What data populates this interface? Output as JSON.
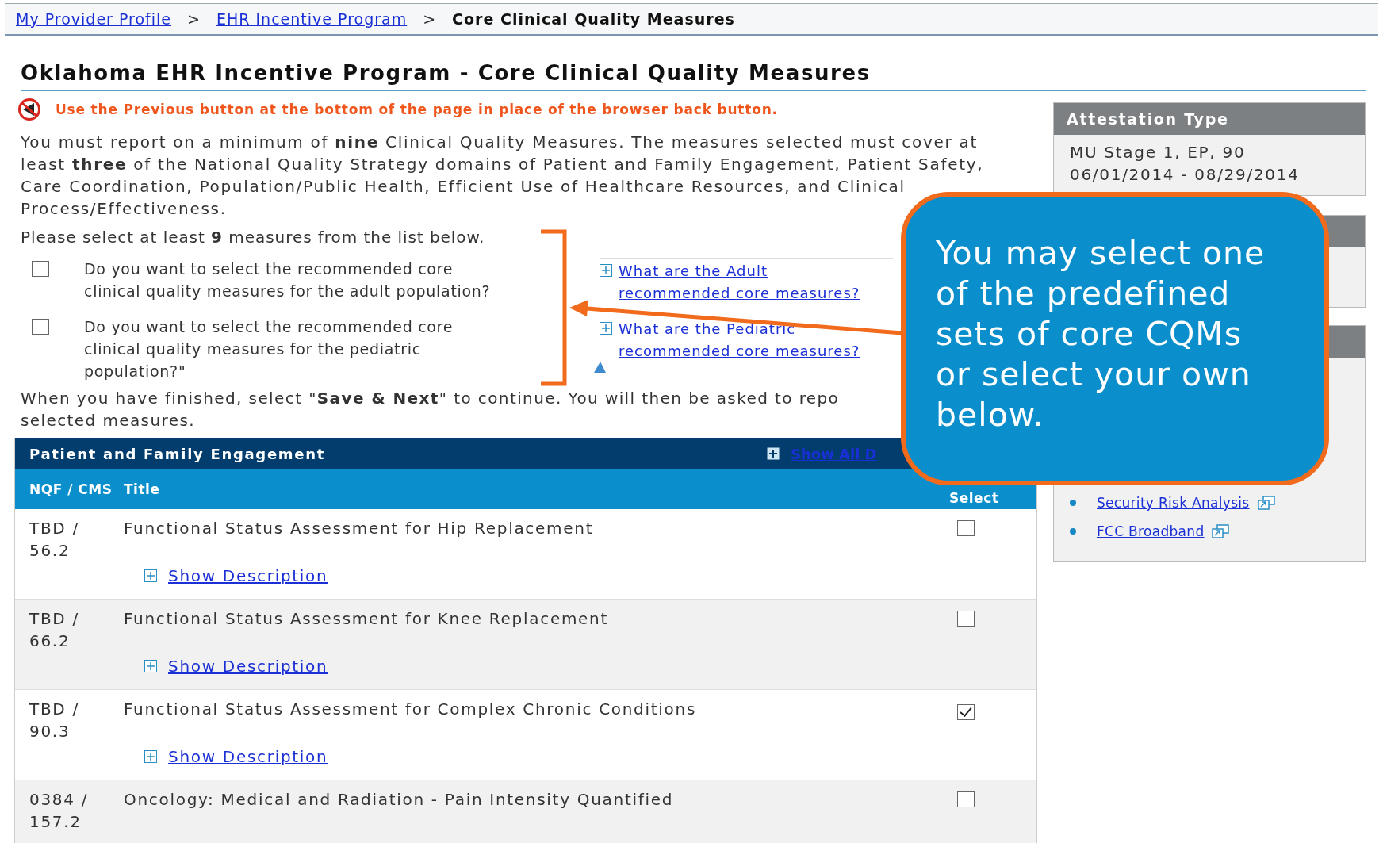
{
  "breadcrumb": [
    {
      "label": "My Provider Profile",
      "link": true
    },
    {
      "label": "EHR Incentive Program",
      "link": true
    },
    {
      "label": "Core Clinical Quality Measures",
      "link": false
    }
  ],
  "breadcrumb_separator": ">",
  "title": "Oklahoma EHR Incentive Program - Core Clinical Quality Measures",
  "warning": "Use the Previous button at the bottom of the page in place of the browser back button.",
  "intro_lines": [
    "You must report on a minimum of **nine** Clinical Quality Measures. The measures selected must cover at",
    "least **three** of the National Quality Strategy domains of Patient and Family Engagement, Patient Safety,",
    "Care Coordination, Population/Public Health, Efficient Use of Healthcare Resources, and Clinical",
    "Process/Effectiveness."
  ],
  "select_prompt": "Please select at least **9** measures from the list below.",
  "recommended": [
    {
      "question_lines": [
        "Do you want to select the recommended core",
        "clinical quality measures for the adult population?"
      ],
      "checked": false,
      "link_lines": [
        "What are the Adult",
        "recommended core measures?"
      ]
    },
    {
      "question_lines": [
        "Do you want to select the recommended core",
        "clinical quality measures for the pediatric",
        "population?\""
      ],
      "checked": false,
      "link_lines": [
        "What are the Pediatric",
        "recommended core measures?"
      ]
    }
  ],
  "finish_lines": [
    "When you have finished, select \"**Save & Next**\" to continue. You will then be asked to repo",
    "selected measures."
  ],
  "section": {
    "title": "Patient and Family Engagement",
    "show_all": "Show All D"
  },
  "columns": [
    "NQF / CMS",
    "Title",
    "Select"
  ],
  "rows": [
    {
      "code": "TBD / 56.2",
      "title": "Functional Status Assessment for Hip Replacement",
      "checked": false,
      "show": "Show Description"
    },
    {
      "code": "TBD / 66.2",
      "title": "Functional Status Assessment for Knee Replacement",
      "checked": false,
      "show": "Show Description"
    },
    {
      "code": "TBD / 90.3",
      "title": "Functional Status Assessment for Complex Chronic Conditions",
      "checked": true,
      "show": "Show Description"
    },
    {
      "code": "0384 / 157.2",
      "title": "Oncology: Medical and Radiation - Pain Intensity Quantified",
      "checked": false
    }
  ],
  "sidebar": {
    "attestation": {
      "header": "Attestation Type",
      "lines": [
        "MU Stage 1, EP, 90",
        "06/01/2014 - 08/29/2014"
      ]
    },
    "links": [
      "Security Risk Analysis",
      "FCC Broadband"
    ]
  },
  "callout": {
    "text": "You may select one of the predefined sets of core CQMs or select your own below."
  }
}
